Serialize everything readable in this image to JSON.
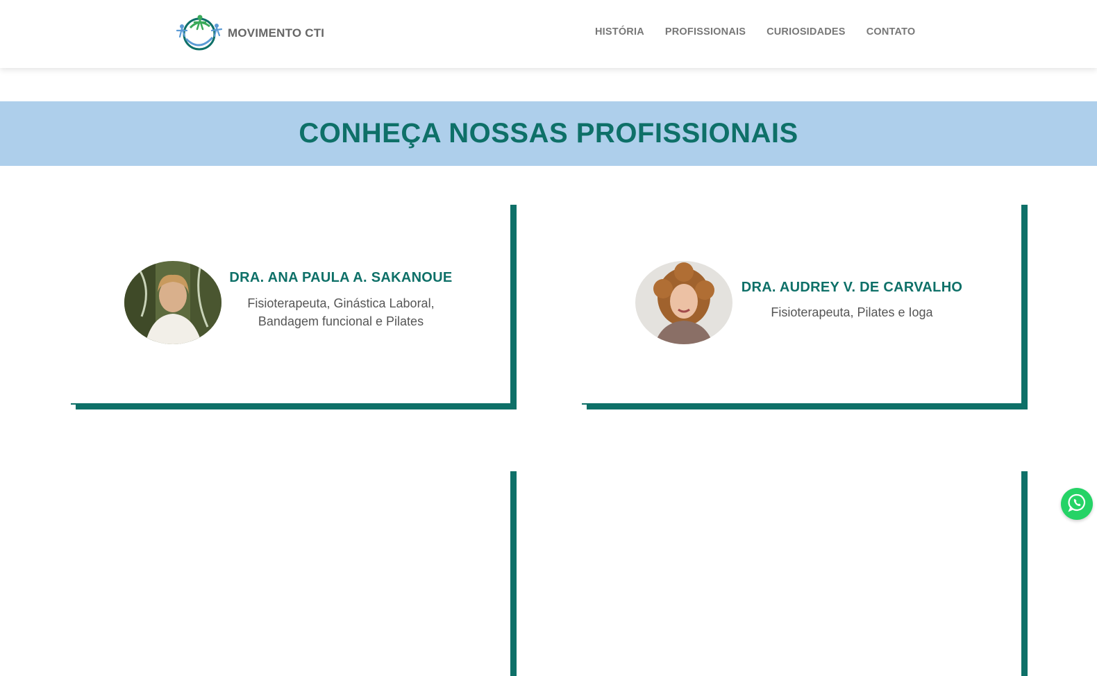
{
  "brand": {
    "name": "MOVIMENTO CTI"
  },
  "nav": {
    "items": [
      {
        "label": "HISTÓRIA"
      },
      {
        "label": "PROFISSIONAIS"
      },
      {
        "label": "CURIOSIDADES"
      },
      {
        "label": "CONTATO"
      }
    ]
  },
  "banner": {
    "title": "CONHEÇA NOSSAS PROFISSIONAIS"
  },
  "professionals": [
    {
      "name": "DRA. ANA PAULA A. SAKANOUE",
      "role_line1": "Fisioterapeuta, Ginástica Laboral,",
      "role_line2": "Bandagem funcional e Pilates"
    },
    {
      "name": "DRA. AUDREY V. DE CARVALHO",
      "role_line1": "Fisioterapeuta, Pilates e Ioga",
      "role_line2": ""
    }
  ],
  "icons": {
    "logo": "movimento-logo-icon",
    "whatsapp": "whatsapp-icon"
  },
  "colors": {
    "accent": "#0e7068",
    "banner": "#aecfeb",
    "whatsapp": "#25d366"
  }
}
